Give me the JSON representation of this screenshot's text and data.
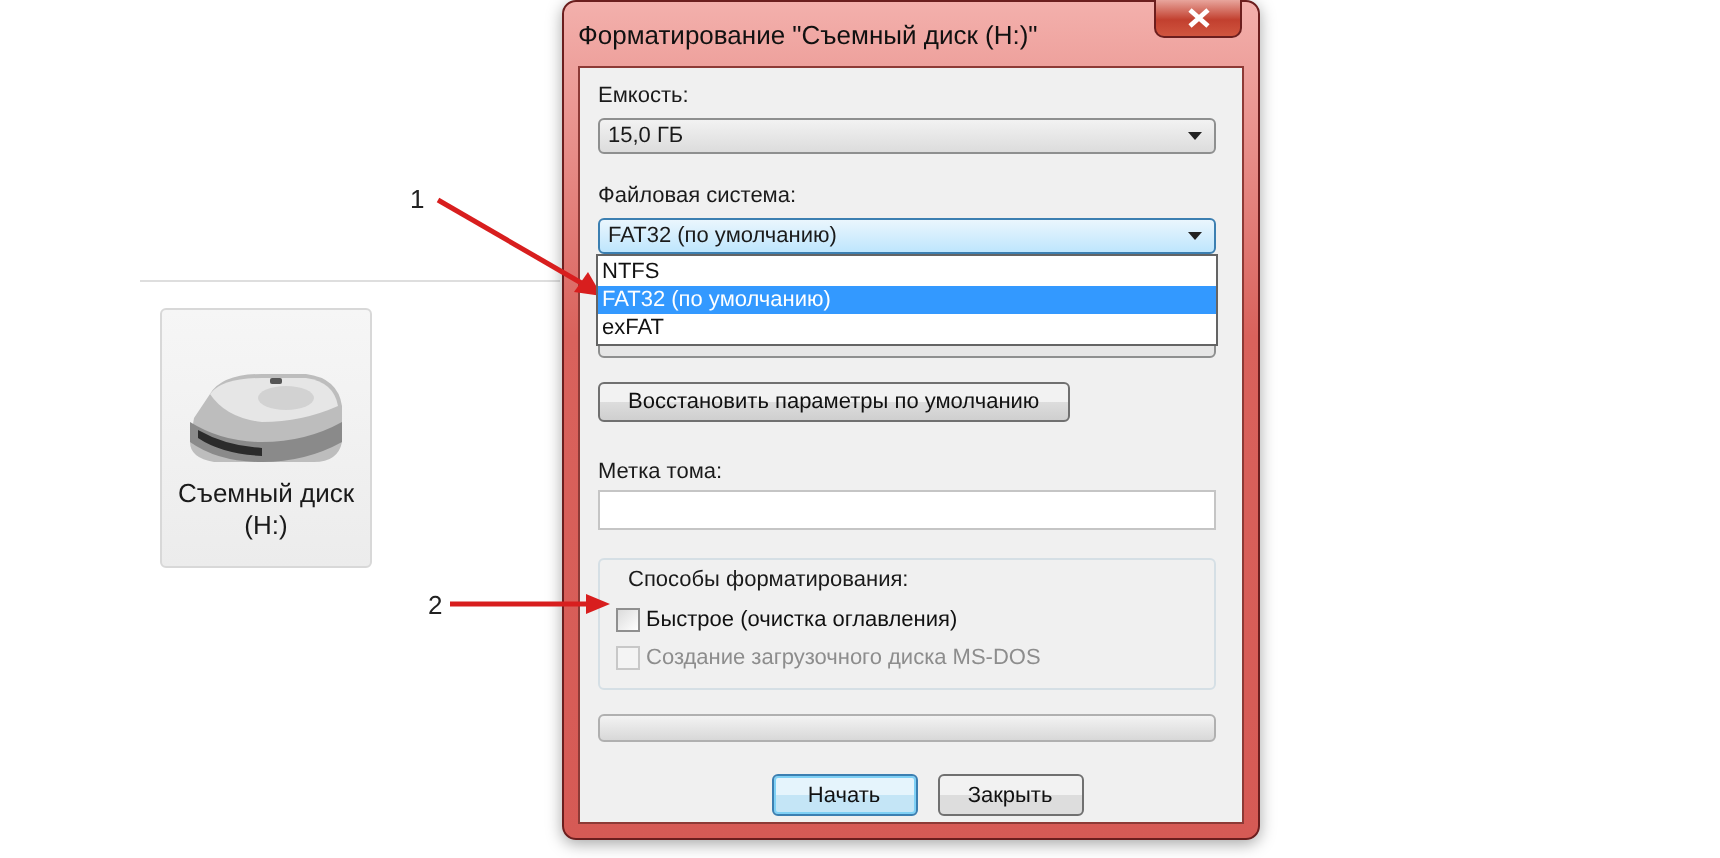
{
  "window": {
    "title": "Форматирование \"Съемный диск (H:)\""
  },
  "capacity": {
    "label": "Емкость:",
    "value": "15,0 ГБ"
  },
  "file_system": {
    "label": "Файловая система:",
    "value": "FAT32 (по умолчанию)",
    "expanded": true,
    "options": [
      {
        "label": "NTFS",
        "selected": false
      },
      {
        "label": "FAT32 (по умолчанию)",
        "selected": true
      },
      {
        "label": "exFAT",
        "selected": false
      }
    ]
  },
  "restore_button": "Восстановить параметры по умолчанию",
  "volume_label": {
    "label": "Метка тома:"
  },
  "format_options": {
    "title": "Способы форматирования:",
    "items": [
      {
        "label": "Быстрое (очистка оглавления)",
        "checked": false,
        "disabled": false
      },
      {
        "label": "Создание загрузочного диска MS-DOS",
        "checked": false,
        "disabled": true
      }
    ]
  },
  "progress": {
    "level": 0
  },
  "buttons": [
    {
      "label": "Начать",
      "default": true
    },
    {
      "label": "Закрыть",
      "default": false
    }
  ],
  "drive": {
    "label": "Съемный диск (H:)"
  },
  "annotations": [
    {
      "label": "1"
    },
    {
      "label": "2"
    }
  ]
}
